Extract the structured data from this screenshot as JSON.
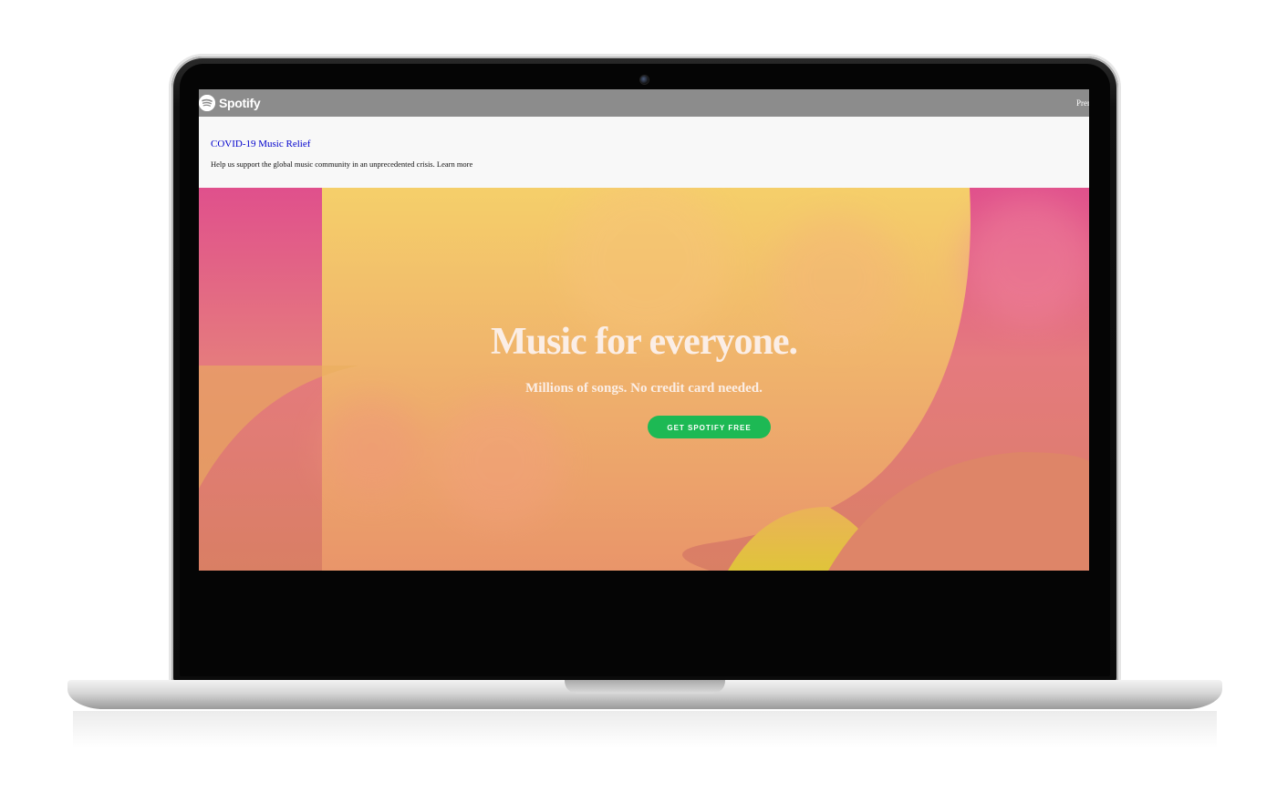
{
  "header": {
    "logo_text": "Spotify",
    "nav_link": "Premium"
  },
  "notice": {
    "title": "COVID-19 Music Relief",
    "text": "Help us support the global music community in an unprecedented crisis.",
    "link": "Learn more"
  },
  "hero": {
    "title": "Music for everyone.",
    "subtitle": "Millions of songs. No credit card needed.",
    "cta_label": "GET SPOTIFY FREE"
  },
  "colors": {
    "accent": "#1db954",
    "hero_pink": "#e85aa0",
    "hero_yellow": "#f2c35a",
    "header_gray": "#8c8c8c"
  },
  "icons": {
    "logo": "spotify-logo-icon"
  }
}
